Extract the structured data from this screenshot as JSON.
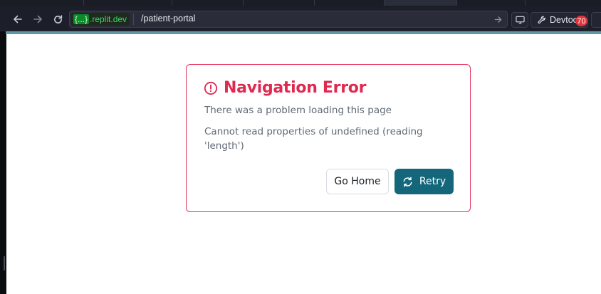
{
  "browser": {
    "url_badge": {
      "brace": "{...}",
      "domain": ".replit.dev"
    },
    "url_path": "/patient-portal",
    "devtools_label": "Devtools",
    "devtools_count": "70"
  },
  "error_card": {
    "title": "Navigation Error",
    "subtitle": "There was a problem loading this page",
    "message": "Cannot read properties of undefined (reading 'length')",
    "home_label": "Go Home",
    "retry_label": "Retry"
  },
  "colors": {
    "error": "#e0294f",
    "retry": "#14677a",
    "accent_line": "#5e98a8"
  },
  "icons": {
    "back": "arrow-left-icon",
    "forward": "arrow-right-icon",
    "reload": "reload-icon",
    "go": "arrow-right-icon",
    "screen": "monitor-icon",
    "devtools": "wrench-icon",
    "alert": "alert-circle-icon",
    "retry": "refresh-icon"
  }
}
